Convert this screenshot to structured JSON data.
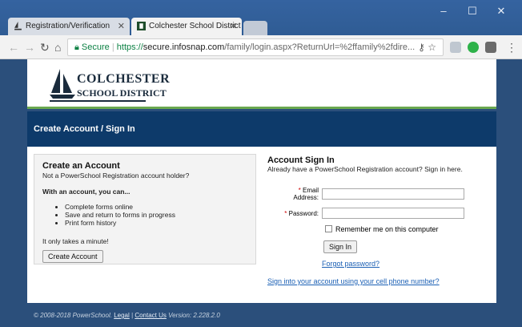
{
  "browser": {
    "tabs": [
      {
        "label": "Registration/Verification",
        "active": false
      },
      {
        "label": "Colchester School District",
        "active": true
      }
    ],
    "window_controls": {
      "minimize": "–",
      "maximize": "☐",
      "close": "✕"
    },
    "address": {
      "secure_label": "Secure",
      "url_scheme": "https://",
      "url_host": "secure.infosnap.com",
      "url_path": "/family/login.aspx?ReturnUrl=%2ffamily%2fdire..."
    }
  },
  "site": {
    "logo_line1": "COLCHESTER",
    "logo_line2": "SCHOOL DISTRICT",
    "page_title": "Create Account / Sign In"
  },
  "create": {
    "heading": "Create an Account",
    "subheading": "Not a PowerSchool Registration account holder?",
    "with_label": "With an account, you can...",
    "benefits": [
      "Complete forms online",
      "Save and return to forms in progress",
      "Print form history"
    ],
    "minute": "It only takes a minute!",
    "button": "Create Account"
  },
  "signin": {
    "heading": "Account Sign In",
    "subheading": "Already have a PowerSchool Registration account? Sign in here.",
    "email_label_1": "Email",
    "email_label_2": "Address:",
    "password_label": "Password:",
    "required_mark": "*",
    "remember_label": "Remember me on this computer",
    "button": "Sign In",
    "forgot": "Forgot password?",
    "phone_link": "Sign into your account using your cell phone number?"
  },
  "footer": {
    "copyright": "© 2008-2018 PowerSchool.",
    "legal": "Legal",
    "contact": "Contact Us",
    "version": "Version: 2.228.2.0"
  },
  "colors": {
    "title_band": "#0d3a6a",
    "page_bg": "#2b4f7b",
    "accent_green": "#6aa84f",
    "link": "#1a5fb4"
  }
}
